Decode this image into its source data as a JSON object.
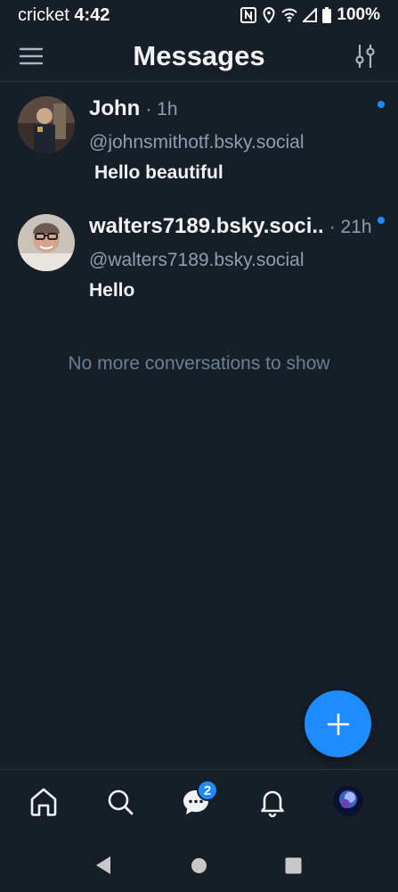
{
  "status_bar": {
    "carrier": "cricket",
    "time": "4:42",
    "battery": "100%"
  },
  "header": {
    "title": "Messages"
  },
  "conversations": [
    {
      "name": "John",
      "time": "· 1h",
      "handle": "@johnsmithotf.bsky.social",
      "last_message": "Hello beautiful",
      "unread": true
    },
    {
      "name": "walters7189.bsky.soci..",
      "time": "· 21h",
      "handle": "@walters7189.bsky.social",
      "last_message": "Hello",
      "unread": true
    }
  ],
  "empty_note": "No more conversations to show",
  "bottom_nav": {
    "items": [
      "home-icon",
      "search-icon",
      "chat-icon",
      "bell-icon",
      "profile-avatar"
    ],
    "chat_badge": "2"
  },
  "colors": {
    "background": "#161e27",
    "accent": "#208bfe",
    "muted_text": "#8d9eb1",
    "divider": "#2a3644"
  }
}
